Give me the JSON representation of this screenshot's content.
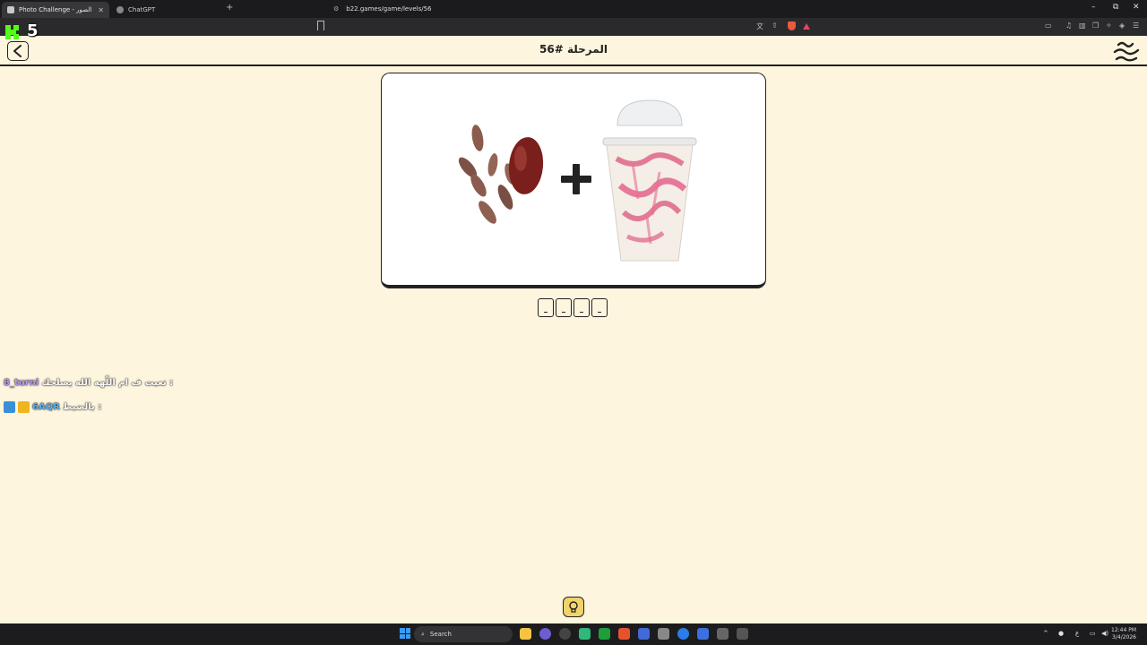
{
  "browser": {
    "tabs": [
      {
        "title": "Photo Challenge - تحدي الصور",
        "active": true
      },
      {
        "title": "ChatGPT",
        "active": false
      }
    ],
    "url": "b22.games/game/levels/56"
  },
  "stream": {
    "overlay_number": "5"
  },
  "header": {
    "level_title": "المرحلة #56"
  },
  "puzzle": {
    "operator": "+",
    "left_image": "dates-and-cocoa-beans",
    "right_image": "strawberry-milkshake-cup",
    "answer_length": 4
  },
  "chat": [
    {
      "user": "8_turni",
      "message": ": تعبت ف ام اللّهه الله يصلحك"
    },
    {
      "user": "6AQR",
      "message": ": بالضبط"
    }
  ],
  "taskbar": {
    "search_label": "Search",
    "time": "12:44 PM",
    "date": "3/4/2026",
    "lang": "ع"
  },
  "colors": {
    "page_bg": "#fdf5dd",
    "hint_bg": "#f1d36a",
    "accent": "#222222"
  }
}
